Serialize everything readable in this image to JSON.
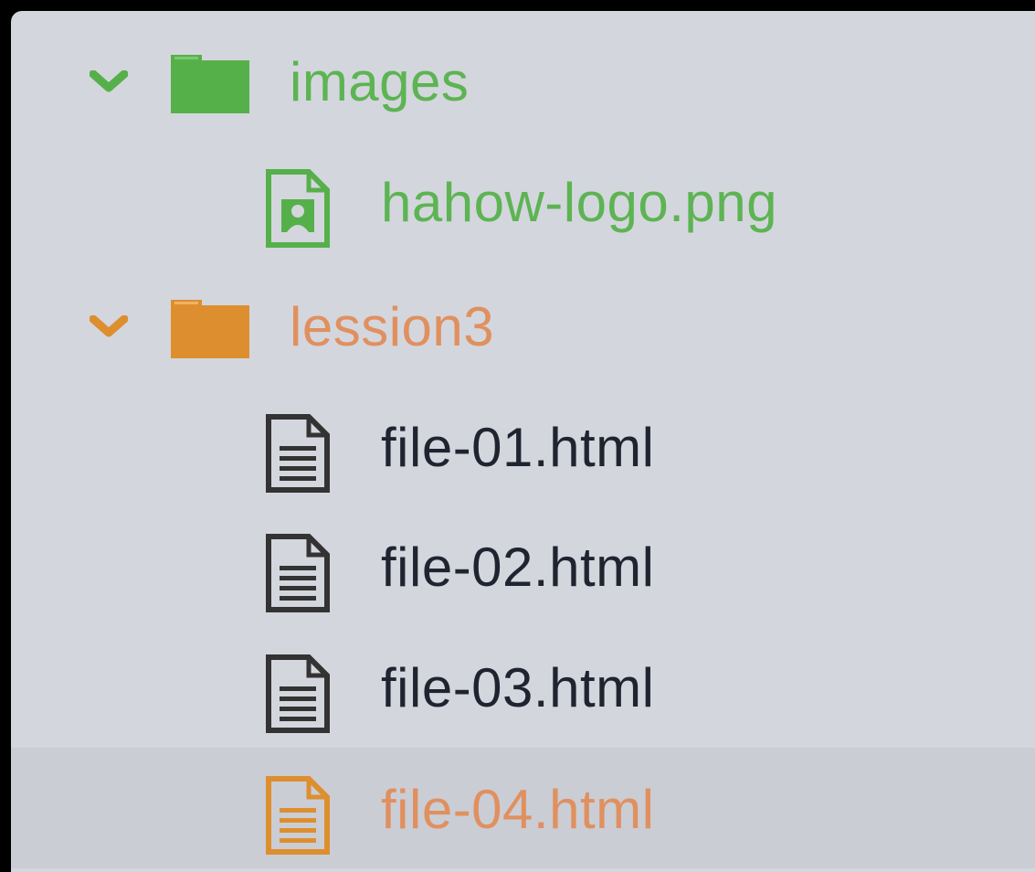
{
  "colors": {
    "panel_bg": "#d4d6dd",
    "selected_bg": "#cbcdd4",
    "green": "#56b04a",
    "green_text": "#5cb452",
    "orange": "#dd8f30",
    "orange_text": "#e0905f",
    "dark_text": "#1f2430",
    "doc_stroke": "#333333"
  },
  "tree": {
    "images_folder": {
      "label": "images",
      "icon": "folder-icon",
      "expanded": true
    },
    "logo_file": {
      "label": "hahow-logo.png",
      "icon": "image-file-icon"
    },
    "lesson_folder": {
      "label": "lession3",
      "icon": "folder-icon",
      "expanded": true
    },
    "files": [
      {
        "label": "file-01.html",
        "icon": "document-icon"
      },
      {
        "label": "file-02.html",
        "icon": "document-icon"
      },
      {
        "label": "file-03.html",
        "icon": "document-icon"
      },
      {
        "label": "file-04.html",
        "icon": "document-icon",
        "modified": true
      }
    ]
  }
}
